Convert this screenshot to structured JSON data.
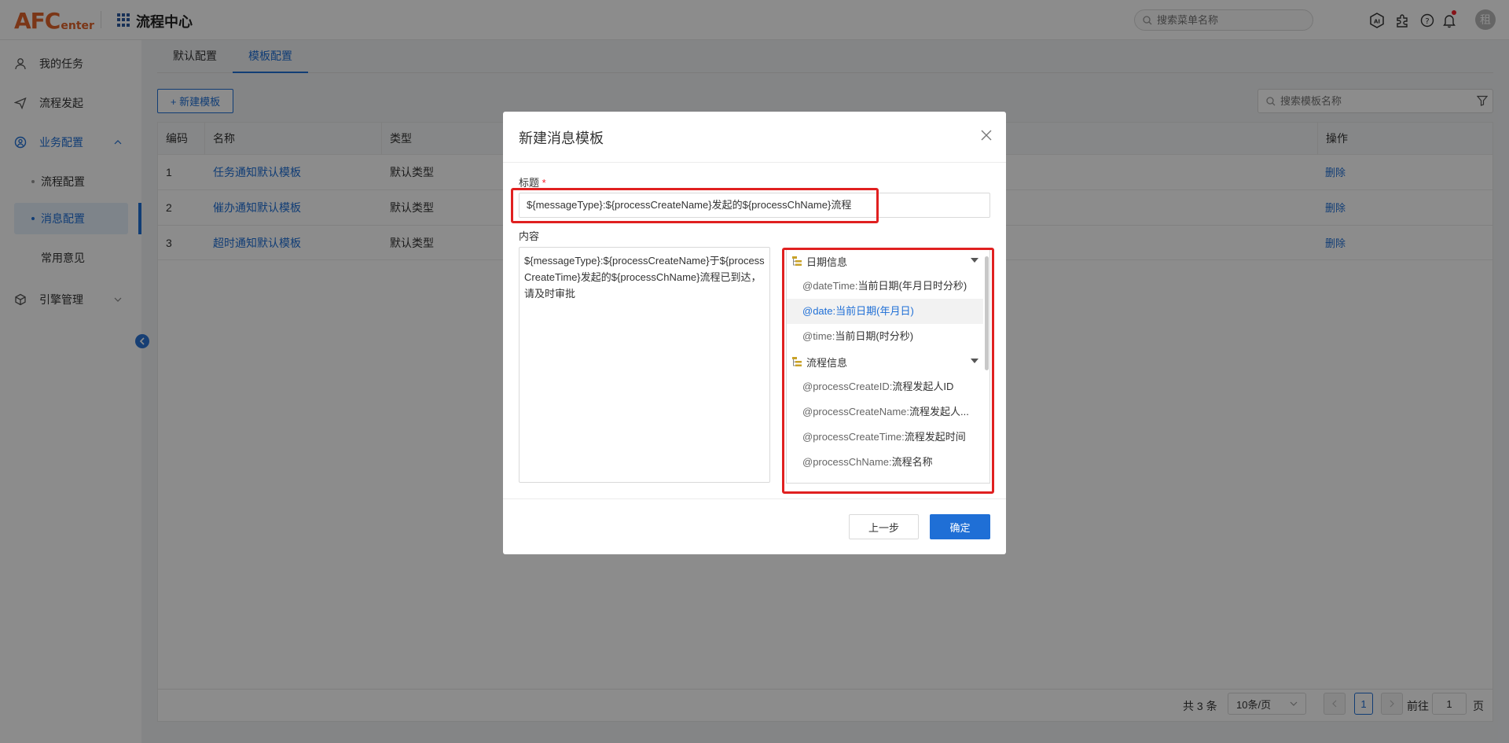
{
  "header": {
    "logo_big": "AFC",
    "logo_small": "enter",
    "app_title": "流程中心",
    "search_placeholder": "搜索菜单名称",
    "avatar_text": "租"
  },
  "sidebar": {
    "items": [
      {
        "label": "我的任务"
      },
      {
        "label": "流程发起"
      },
      {
        "label": "业务配置"
      },
      {
        "label": "流程配置"
      },
      {
        "label": "消息配置"
      },
      {
        "label": "常用意见"
      },
      {
        "label": "引擎管理"
      }
    ]
  },
  "tabs": [
    {
      "label": "默认配置"
    },
    {
      "label": "模板配置"
    }
  ],
  "toolbar": {
    "new_label": "+ 新建模板",
    "search_placeholder": "搜索模板名称"
  },
  "table": {
    "headers": [
      "编码",
      "名称",
      "类型",
      "操作"
    ],
    "rows": [
      {
        "code": "1",
        "name": "任务通知默认模板",
        "type": "默认类型",
        "action": "删除"
      },
      {
        "code": "2",
        "name": "催办通知默认模板",
        "type": "默认类型",
        "action": "删除"
      },
      {
        "code": "3",
        "name": "超时通知默认模板",
        "type": "默认类型",
        "action": "删除"
      }
    ]
  },
  "pagination": {
    "total": "共 3 条",
    "page_size": "10条/页",
    "current": "1",
    "goto_label": "前往",
    "goto_value": "1",
    "page_suffix": "页"
  },
  "modal": {
    "title": "新建消息模板",
    "title_label": "标题",
    "required_mark": "*",
    "title_value": "${messageType}:${processCreateName}发起的${processChName}流程",
    "content_label": "内容",
    "content_value": "${messageType}:${processCreateName}于${processCreateTime}发起的${processChName}流程已到达，请及时审批",
    "variable_groups": [
      {
        "name": "日期信息",
        "items": [
          {
            "key": "@dateTime:",
            "desc": "当前日期(年月日时分秒)"
          },
          {
            "key": "@date:",
            "desc": "当前日期(年月日)"
          },
          {
            "key": "@time:",
            "desc": "当前日期(时分秒)"
          }
        ]
      },
      {
        "name": "流程信息",
        "items": [
          {
            "key": "@processCreateID:",
            "desc": "流程发起人ID"
          },
          {
            "key": "@processCreateName:",
            "desc": "流程发起人..."
          },
          {
            "key": "@processCreateTime:",
            "desc": "流程发起时间"
          },
          {
            "key": "@processChName:",
            "desc": "流程名称"
          }
        ]
      }
    ],
    "prev_label": "上一步",
    "ok_label": "确定"
  },
  "colors": {
    "accent": "#1f6fd6",
    "logo": "#e0632a",
    "highlight_box": "#e02020"
  }
}
